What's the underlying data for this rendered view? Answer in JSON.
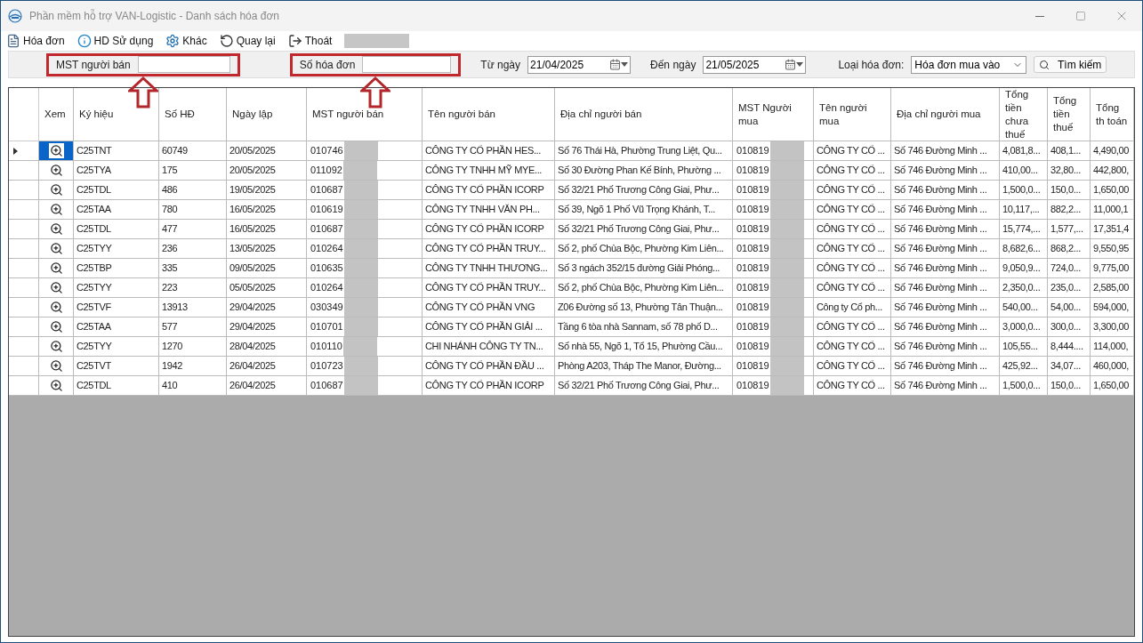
{
  "window": {
    "title": "Phần mềm hỗ trợ VAN-Logistic - Danh sách hóa đơn"
  },
  "toolbar": [
    {
      "label": "Hóa đơn",
      "kind": "invoice"
    },
    {
      "label": "HD Sử dụng",
      "kind": "guide"
    },
    {
      "label": "Khác",
      "kind": "other"
    },
    {
      "label": "Quay lại",
      "kind": "back"
    },
    {
      "label": "Thoát",
      "kind": "exit"
    }
  ],
  "filters": {
    "seller_tax": {
      "label": "MST người bán",
      "highlighted": true
    },
    "invoice_no": {
      "label": "Số hóa đơn",
      "highlighted": true
    },
    "from_date": {
      "label": "Từ ngày",
      "value": "21/04/2025"
    },
    "to_date": {
      "label": "Đến ngày",
      "value": "21/05/2025"
    },
    "invoice_type": {
      "label": "Loại hóa đơn:",
      "value": "Hóa đơn mua vào"
    },
    "search_button": "Tìm kiếm"
  },
  "table": {
    "columns": [
      {
        "label": "Xem",
        "kind": "view"
      },
      {
        "label": "Ký hiệu",
        "kind": "text"
      },
      {
        "label": "Số HĐ",
        "kind": "text"
      },
      {
        "label": "Ngày lập",
        "kind": "text"
      },
      {
        "label": "MST người bán",
        "kind": "redacted"
      },
      {
        "label": "Tên người bán",
        "kind": "text"
      },
      {
        "label": "Địa chỉ người bán",
        "kind": "text"
      },
      {
        "label": "MST Người mua",
        "kind": "redacted"
      },
      {
        "label": "Tên người mua",
        "kind": "text"
      },
      {
        "label": "Địa chỉ người mua",
        "kind": "text"
      },
      {
        "label": "Tổng tiền chưa thuế",
        "kind": "text"
      },
      {
        "label": "Tổng tiền thuế",
        "kind": "text"
      },
      {
        "label": "Tổng th toán",
        "kind": "text"
      }
    ],
    "rows": [
      {
        "selected": true,
        "cells": [
          "",
          "C25TNT",
          "60749",
          "20/05/2025",
          "010746",
          "CÔNG TY CỔ PHẦN HES...",
          "Số 76 Thái Hà, Phường Trung Liệt, Qu...",
          "010819",
          "CÔNG TY CỔ ...",
          "Số 746 Đường Minh ...",
          "4,081,8...",
          "408,1...",
          "4,490,00"
        ]
      },
      {
        "selected": false,
        "cells": [
          "",
          "C25TYA",
          "175",
          "20/05/2025",
          "011092",
          "CÔNG TY TNHH MỸ MYE...",
          "Số 30 Đường Phan Kế Bính, Phường ...",
          "010819",
          "CÔNG TY CỔ ...",
          "Số 746 Đường Minh ...",
          "410,00...",
          "32,80...",
          "442,800,"
        ]
      },
      {
        "selected": false,
        "cells": [
          "",
          "C25TDL",
          "486",
          "19/05/2025",
          "010687",
          "CÔNG TY CỔ PHẦN ICORP",
          "Số 32/21 Phố Trương Công Giai, Phư...",
          "010819",
          "CÔNG TY CỔ ...",
          "Số 746 Đường Minh ...",
          "1,500,0...",
          "150,0...",
          "1,650,00"
        ]
      },
      {
        "selected": false,
        "cells": [
          "",
          "C25TAA",
          "780",
          "16/05/2025",
          "010619",
          "CÔNG TY TNHH VĂN PH...",
          "Số 39, Ngõ 1 Phố Vũ Trọng Khánh, T...",
          "010819",
          "CÔNG TY CỔ ...",
          "Số 746 Đường Minh ...",
          "10,117,...",
          "882,2...",
          "11,000,1"
        ]
      },
      {
        "selected": false,
        "cells": [
          "",
          "C25TDL",
          "477",
          "16/05/2025",
          "010687",
          "CÔNG TY CỔ PHẦN ICORP",
          "Số 32/21 Phố Trương Công Giai, Phư...",
          "010819",
          "CÔNG TY CỔ ...",
          "Số 746 Đường Minh ...",
          "15,774,...",
          "1,577,...",
          "17,351,4"
        ]
      },
      {
        "selected": false,
        "cells": [
          "",
          "C25TYY",
          "236",
          "13/05/2025",
          "010264",
          "CÔNG TY CỔ PHẦN TRUY...",
          "Số 2, phố Chùa Bộc, Phường Kim Liên...",
          "010819",
          "CÔNG TY CỔ ...",
          "Số 746 Đường Minh ...",
          "8,682,6...",
          "868,2...",
          "9,550,95"
        ]
      },
      {
        "selected": false,
        "cells": [
          "",
          "C25TBP",
          "335",
          "09/05/2025",
          "010635",
          "CÔNG TY TNHH THƯƠNG...",
          "Số 3 ngách 352/15 đường Giải Phóng...",
          "010819",
          "CÔNG TY CỔ ...",
          "Số 746 Đường Minh ...",
          "9,050,9...",
          "724,0...",
          "9,775,00"
        ]
      },
      {
        "selected": false,
        "cells": [
          "",
          "C25TYY",
          "223",
          "05/05/2025",
          "010264",
          "CÔNG TY CỔ PHẦN TRUY...",
          "Số 2, phố Chùa Bộc, Phường Kim Liên...",
          "010819",
          "CÔNG TY CỔ ...",
          "Số 746 Đường Minh ...",
          "2,350,0...",
          "235,0...",
          "2,585,00"
        ]
      },
      {
        "selected": false,
        "cells": [
          "",
          "C25TVF",
          "13913",
          "29/04/2025",
          "030349",
          "CÔNG TY CỔ PHẦN VNG",
          "Z06 Đường số 13, Phường Tân Thuận...",
          "010819",
          "Công ty Cổ ph...",
          "Số 746 Đường Minh ...",
          "540,00...",
          "54,00...",
          "594,000,"
        ]
      },
      {
        "selected": false,
        "cells": [
          "",
          "C25TAA",
          "577",
          "29/04/2025",
          "010701",
          "CÔNG TY CỔ PHẦN GIẢI ...",
          "Tầng 6 tòa nhà Sannam, số 78 phố D...",
          "010819",
          "CÔNG TY CỔ ...",
          "Số 746 Đường Minh ...",
          "3,000,0...",
          "300,0...",
          "3,300,00"
        ]
      },
      {
        "selected": false,
        "cells": [
          "",
          "C25TYY",
          "1270",
          "28/04/2025",
          "010110",
          "CHI NHÁNH CÔNG TY TN...",
          "Số nhà 55, Ngõ 1, Tổ 15, Phường Cầu...",
          "010819",
          "CÔNG TY CỔ ...",
          "Số 746 Đường Minh ...",
          "105,55...",
          "8,444....",
          "114,000,"
        ]
      },
      {
        "selected": false,
        "cells": [
          "",
          "C25TVT",
          "1942",
          "26/04/2025",
          "010723",
          "CÔNG TY CỔ PHẦN ĐẦU ...",
          "Phòng A203, Tháp The Manor, Đường...",
          "010819",
          "CÔNG TY CỔ ...",
          "Số 746 Đường Minh ...",
          "425,92...",
          "34,07...",
          "460,000,"
        ]
      },
      {
        "selected": false,
        "cells": [
          "",
          "C25TDL",
          "410",
          "26/04/2025",
          "010687",
          "CÔNG TY CỔ PHẦN ICORP",
          "Số 32/21 Phố Trương Công Giai, Phư...",
          "010819",
          "CÔNG TY CỔ ...",
          "Số 746 Đường Minh ...",
          "1,500,0...",
          "150,0...",
          "1,650,00"
        ]
      }
    ]
  }
}
